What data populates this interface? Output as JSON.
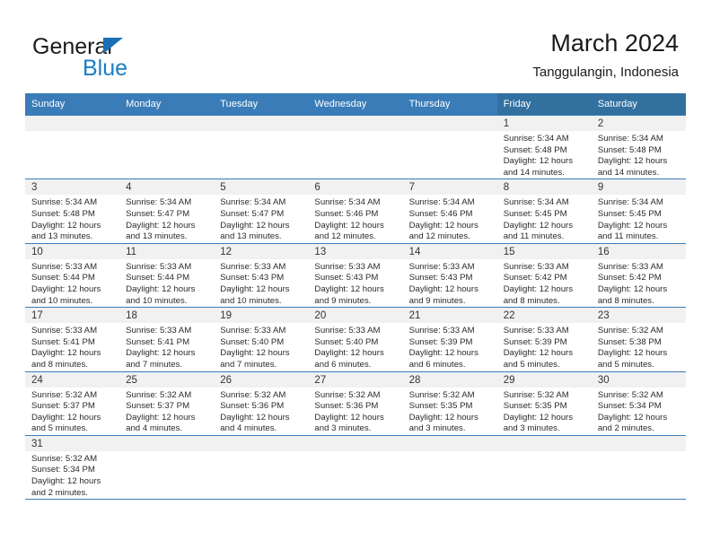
{
  "brand": {
    "name_top": "General",
    "name_bottom": "Blue",
    "accent_color": "#1b7ec4",
    "triangle_color": "#1b6fb5"
  },
  "header": {
    "title": "March 2024",
    "subtitle": "Tanggulangin, Indonesia"
  },
  "theme": {
    "header_blue": "#3a7cb8",
    "weekend_header_blue": "#32709f",
    "daynum_strip": "#f1f1f1",
    "text": "#2b2b2b"
  },
  "weekdays": [
    {
      "label": "Sunday",
      "weekend": false
    },
    {
      "label": "Monday",
      "weekend": false
    },
    {
      "label": "Tuesday",
      "weekend": false
    },
    {
      "label": "Wednesday",
      "weekend": false
    },
    {
      "label": "Thursday",
      "weekend": false
    },
    {
      "label": "Friday",
      "weekend": true
    },
    {
      "label": "Saturday",
      "weekend": true
    }
  ],
  "weeks": [
    [
      {
        "day": ""
      },
      {
        "day": ""
      },
      {
        "day": ""
      },
      {
        "day": ""
      },
      {
        "day": ""
      },
      {
        "day": "1",
        "sunrise": "Sunrise: 5:34 AM",
        "sunset": "Sunset: 5:48 PM",
        "daylight_line1": "Daylight: 12 hours",
        "daylight_line2": "and 14 minutes."
      },
      {
        "day": "2",
        "sunrise": "Sunrise: 5:34 AM",
        "sunset": "Sunset: 5:48 PM",
        "daylight_line1": "Daylight: 12 hours",
        "daylight_line2": "and 14 minutes."
      }
    ],
    [
      {
        "day": "3",
        "sunrise": "Sunrise: 5:34 AM",
        "sunset": "Sunset: 5:48 PM",
        "daylight_line1": "Daylight: 12 hours",
        "daylight_line2": "and 13 minutes."
      },
      {
        "day": "4",
        "sunrise": "Sunrise: 5:34 AM",
        "sunset": "Sunset: 5:47 PM",
        "daylight_line1": "Daylight: 12 hours",
        "daylight_line2": "and 13 minutes."
      },
      {
        "day": "5",
        "sunrise": "Sunrise: 5:34 AM",
        "sunset": "Sunset: 5:47 PM",
        "daylight_line1": "Daylight: 12 hours",
        "daylight_line2": "and 13 minutes."
      },
      {
        "day": "6",
        "sunrise": "Sunrise: 5:34 AM",
        "sunset": "Sunset: 5:46 PM",
        "daylight_line1": "Daylight: 12 hours",
        "daylight_line2": "and 12 minutes."
      },
      {
        "day": "7",
        "sunrise": "Sunrise: 5:34 AM",
        "sunset": "Sunset: 5:46 PM",
        "daylight_line1": "Daylight: 12 hours",
        "daylight_line2": "and 12 minutes."
      },
      {
        "day": "8",
        "sunrise": "Sunrise: 5:34 AM",
        "sunset": "Sunset: 5:45 PM",
        "daylight_line1": "Daylight: 12 hours",
        "daylight_line2": "and 11 minutes."
      },
      {
        "day": "9",
        "sunrise": "Sunrise: 5:34 AM",
        "sunset": "Sunset: 5:45 PM",
        "daylight_line1": "Daylight: 12 hours",
        "daylight_line2": "and 11 minutes."
      }
    ],
    [
      {
        "day": "10",
        "sunrise": "Sunrise: 5:33 AM",
        "sunset": "Sunset: 5:44 PM",
        "daylight_line1": "Daylight: 12 hours",
        "daylight_line2": "and 10 minutes."
      },
      {
        "day": "11",
        "sunrise": "Sunrise: 5:33 AM",
        "sunset": "Sunset: 5:44 PM",
        "daylight_line1": "Daylight: 12 hours",
        "daylight_line2": "and 10 minutes."
      },
      {
        "day": "12",
        "sunrise": "Sunrise: 5:33 AM",
        "sunset": "Sunset: 5:43 PM",
        "daylight_line1": "Daylight: 12 hours",
        "daylight_line2": "and 10 minutes."
      },
      {
        "day": "13",
        "sunrise": "Sunrise: 5:33 AM",
        "sunset": "Sunset: 5:43 PM",
        "daylight_line1": "Daylight: 12 hours",
        "daylight_line2": "and 9 minutes."
      },
      {
        "day": "14",
        "sunrise": "Sunrise: 5:33 AM",
        "sunset": "Sunset: 5:43 PM",
        "daylight_line1": "Daylight: 12 hours",
        "daylight_line2": "and 9 minutes."
      },
      {
        "day": "15",
        "sunrise": "Sunrise: 5:33 AM",
        "sunset": "Sunset: 5:42 PM",
        "daylight_line1": "Daylight: 12 hours",
        "daylight_line2": "and 8 minutes."
      },
      {
        "day": "16",
        "sunrise": "Sunrise: 5:33 AM",
        "sunset": "Sunset: 5:42 PM",
        "daylight_line1": "Daylight: 12 hours",
        "daylight_line2": "and 8 minutes."
      }
    ],
    [
      {
        "day": "17",
        "sunrise": "Sunrise: 5:33 AM",
        "sunset": "Sunset: 5:41 PM",
        "daylight_line1": "Daylight: 12 hours",
        "daylight_line2": "and 8 minutes."
      },
      {
        "day": "18",
        "sunrise": "Sunrise: 5:33 AM",
        "sunset": "Sunset: 5:41 PM",
        "daylight_line1": "Daylight: 12 hours",
        "daylight_line2": "and 7 minutes."
      },
      {
        "day": "19",
        "sunrise": "Sunrise: 5:33 AM",
        "sunset": "Sunset: 5:40 PM",
        "daylight_line1": "Daylight: 12 hours",
        "daylight_line2": "and 7 minutes."
      },
      {
        "day": "20",
        "sunrise": "Sunrise: 5:33 AM",
        "sunset": "Sunset: 5:40 PM",
        "daylight_line1": "Daylight: 12 hours",
        "daylight_line2": "and 6 minutes."
      },
      {
        "day": "21",
        "sunrise": "Sunrise: 5:33 AM",
        "sunset": "Sunset: 5:39 PM",
        "daylight_line1": "Daylight: 12 hours",
        "daylight_line2": "and 6 minutes."
      },
      {
        "day": "22",
        "sunrise": "Sunrise: 5:33 AM",
        "sunset": "Sunset: 5:39 PM",
        "daylight_line1": "Daylight: 12 hours",
        "daylight_line2": "and 5 minutes."
      },
      {
        "day": "23",
        "sunrise": "Sunrise: 5:32 AM",
        "sunset": "Sunset: 5:38 PM",
        "daylight_line1": "Daylight: 12 hours",
        "daylight_line2": "and 5 minutes."
      }
    ],
    [
      {
        "day": "24",
        "sunrise": "Sunrise: 5:32 AM",
        "sunset": "Sunset: 5:37 PM",
        "daylight_line1": "Daylight: 12 hours",
        "daylight_line2": "and 5 minutes."
      },
      {
        "day": "25",
        "sunrise": "Sunrise: 5:32 AM",
        "sunset": "Sunset: 5:37 PM",
        "daylight_line1": "Daylight: 12 hours",
        "daylight_line2": "and 4 minutes."
      },
      {
        "day": "26",
        "sunrise": "Sunrise: 5:32 AM",
        "sunset": "Sunset: 5:36 PM",
        "daylight_line1": "Daylight: 12 hours",
        "daylight_line2": "and 4 minutes."
      },
      {
        "day": "27",
        "sunrise": "Sunrise: 5:32 AM",
        "sunset": "Sunset: 5:36 PM",
        "daylight_line1": "Daylight: 12 hours",
        "daylight_line2": "and 3 minutes."
      },
      {
        "day": "28",
        "sunrise": "Sunrise: 5:32 AM",
        "sunset": "Sunset: 5:35 PM",
        "daylight_line1": "Daylight: 12 hours",
        "daylight_line2": "and 3 minutes."
      },
      {
        "day": "29",
        "sunrise": "Sunrise: 5:32 AM",
        "sunset": "Sunset: 5:35 PM",
        "daylight_line1": "Daylight: 12 hours",
        "daylight_line2": "and 3 minutes."
      },
      {
        "day": "30",
        "sunrise": "Sunrise: 5:32 AM",
        "sunset": "Sunset: 5:34 PM",
        "daylight_line1": "Daylight: 12 hours",
        "daylight_line2": "and 2 minutes."
      }
    ],
    [
      {
        "day": "31",
        "sunrise": "Sunrise: 5:32 AM",
        "sunset": "Sunset: 5:34 PM",
        "daylight_line1": "Daylight: 12 hours",
        "daylight_line2": "and 2 minutes."
      },
      {
        "day": ""
      },
      {
        "day": ""
      },
      {
        "day": ""
      },
      {
        "day": ""
      },
      {
        "day": ""
      },
      {
        "day": ""
      }
    ]
  ]
}
